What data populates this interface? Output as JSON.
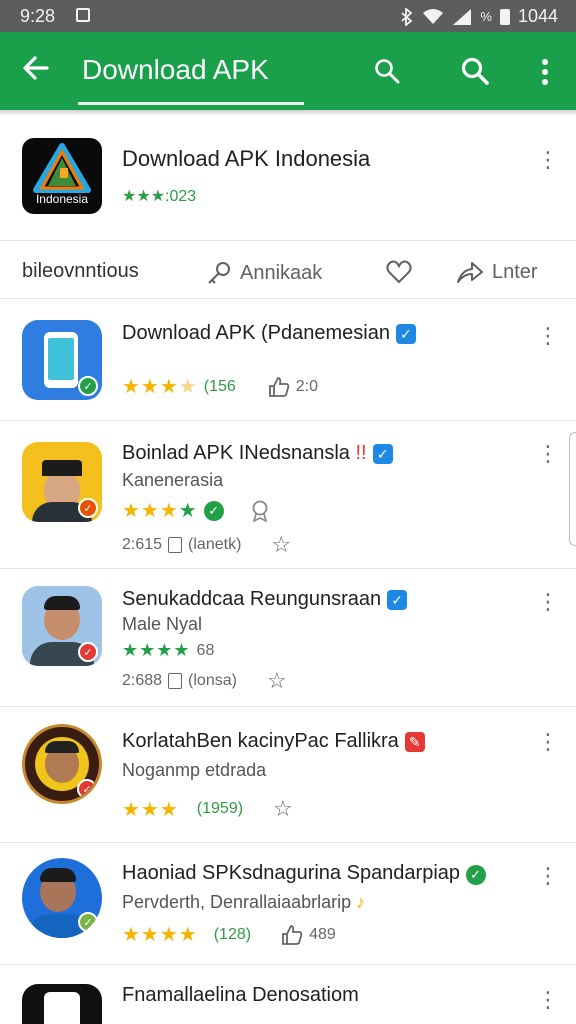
{
  "status_bar": {
    "time": "9:28",
    "battery": "1044"
  },
  "app_bar": {
    "title": "Download APK"
  },
  "header_app": {
    "title": "Download APK Indonesia",
    "rating": "★★★:023",
    "icon_label": "Indonesia"
  },
  "actions": {
    "a1": "bileovnntious",
    "a2": "Annikaak",
    "a3": "Lnter"
  },
  "apps": [
    {
      "title": "Download APK (Pdanemesian",
      "rating_count": "(156",
      "extra": "2:0",
      "verify_color": "#1e88e5"
    },
    {
      "title": "Boinlad APK INedsnansla",
      "flag": "!!",
      "sub": "Kanenerasia",
      "meta1": "2:615",
      "meta2": "(lanetk)",
      "verify_color": "#1e88e5"
    },
    {
      "title": "Senukaddcaa Reungunsraan",
      "sub": "Male Nyal",
      "rating_count": "68",
      "meta1": "2:688",
      "meta2": "(lonsa)",
      "verify_color": "#1e88e5"
    },
    {
      "title": "KorlatahBen kacinyPac Fallikra",
      "sub": "Noganmp etdrada",
      "rating_count": "(1959)",
      "verify_color": "#e53935"
    },
    {
      "title": "Haoniad SPKsdnagurina Spandarpiap",
      "sub": "Pervderth, Denrallaiaabrlarip",
      "sub_mark": "♪",
      "rating_count": "(128)",
      "extra": "489"
    },
    {
      "title": "Fnamallaelina Denosatiom"
    }
  ],
  "colors": {
    "accent": "#1aa04a",
    "star": "#f4b400",
    "verified": "#1e88e5"
  }
}
